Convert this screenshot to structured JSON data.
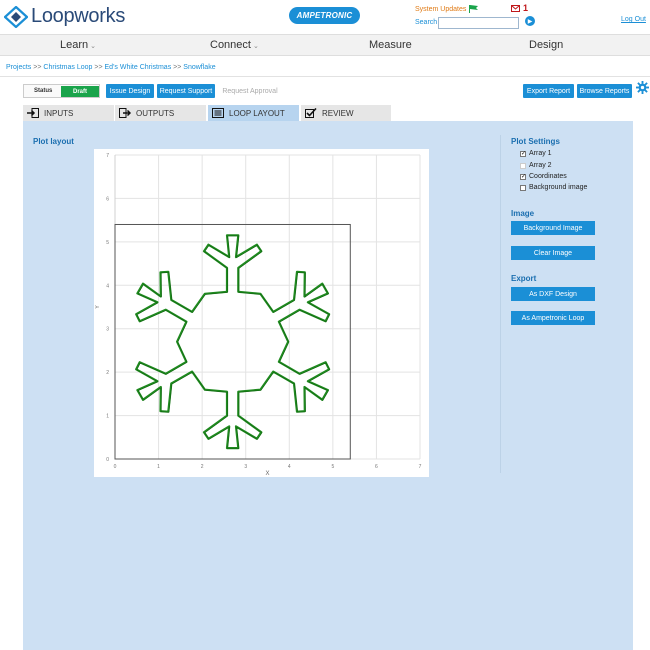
{
  "header": {
    "logo_text": "Loopworks",
    "brand": "AMPETRONIC",
    "system_updates": "System Updates",
    "mail_count": "1",
    "search_label": "Search",
    "search_value": "",
    "logout": "Log Out"
  },
  "nav": {
    "learn": "Learn",
    "connect": "Connect",
    "measure": "Measure",
    "design": "Design"
  },
  "breadcrumb": {
    "projects": "Projects",
    "sep": ">>",
    "christmas_loop": "Christmas Loop",
    "eds_white_christmas": "Ed's White Christmas",
    "snowflake": "Snowflake"
  },
  "toolbar": {
    "status_label": "Status",
    "status_value": "Draft",
    "issue_design": "Issue Design",
    "request_support": "Request Support",
    "request_approval": "Request Approval",
    "export_report": "Export Report",
    "browse_reports": "Browse Reports"
  },
  "tabs": {
    "inputs": "INPUTS",
    "outputs": "OUTPUTS",
    "loop_layout": "LOOP LAYOUT",
    "review": "REVIEW"
  },
  "plot": {
    "title": "Plot layout",
    "x_label": "X",
    "y_label": "Y"
  },
  "settings": {
    "title": "Plot Settings",
    "array1": "Array 1",
    "array2": "Array 2",
    "coordinates": "Coordinates",
    "background_image": "Background image",
    "array1_checked": true,
    "array2_checked": false,
    "coordinates_checked": true,
    "background_checked": false
  },
  "image_section": {
    "title": "Image",
    "background_image_btn": "Background Image",
    "clear_image_btn": "Clear Image"
  },
  "export_section": {
    "title": "Export",
    "dxf_btn": "As DXF Design",
    "ampetronic_btn": "As Ampetronic Loop"
  },
  "colors": {
    "accent": "#1b8fd6",
    "draft": "#1aa44b",
    "loop": "#1f8a1f",
    "panel": "#cde0f3"
  },
  "chart_data": {
    "type": "scatter",
    "x_ticks": [
      "0",
      "1",
      "2",
      "3",
      "4",
      "5",
      "6",
      "7"
    ],
    "y_ticks": [
      "0",
      "1",
      "2",
      "3",
      "4",
      "5",
      "6",
      "7"
    ],
    "xlim": [
      0,
      7
    ],
    "ylim": [
      0,
      7
    ],
    "grid": true,
    "boundary": [
      [
        0,
        0
      ],
      [
        5.4,
        0
      ],
      [
        5.4,
        5.4
      ],
      [
        0,
        5.4
      ]
    ],
    "snowflake_center": [
      2.7,
      2.7
    ],
    "snowflake_arm_outer_radius": 2.45,
    "snowflake_arm_inner_radius": 1.25
  }
}
